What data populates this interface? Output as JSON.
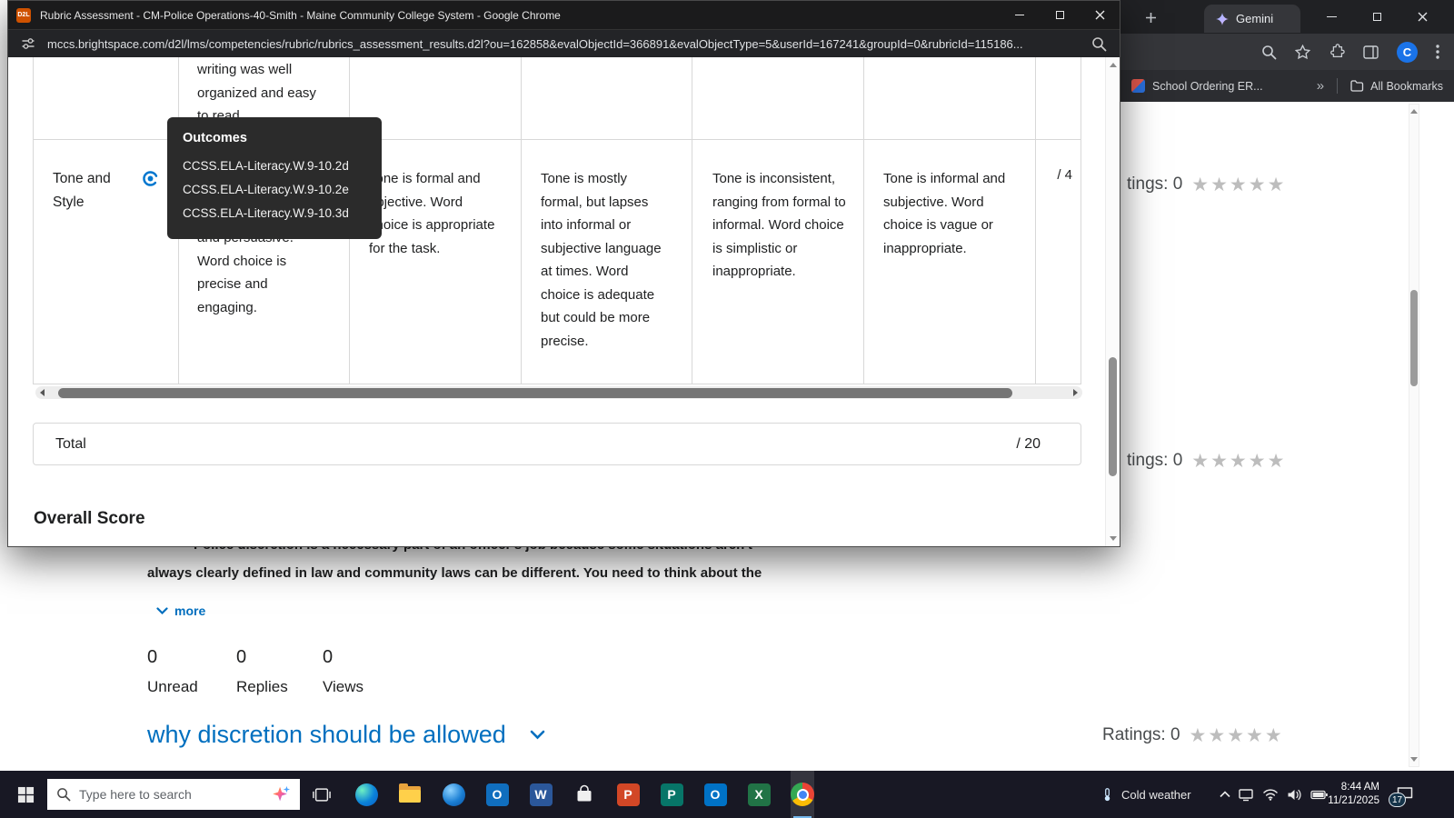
{
  "front_window": {
    "favicon_label": "D2L",
    "title": "Rubric Assessment - CM-Police Operations-40-Smith - Maine Community College System - Google Chrome",
    "url": "mccs.brightspace.com/d2l/lms/competencies/rubric/rubrics_assessment_results.d2l?ou=162858&evalObjectId=366891&evalObjectType=5&userId=167241&groupId=0&rubricId=115186..."
  },
  "rubric": {
    "prev_fragment": "writing was well organized and easy to read.",
    "tooltip_title": "Outcomes",
    "tooltip_items": [
      "CCSS.ELA-Literacy.W.9-10.2d",
      "CCSS.ELA-Literacy.W.9-10.2e",
      "CCSS.ELA-Literacy.W.9-10.3d"
    ],
    "criterion": "Tone and Style",
    "levels": [
      "and persuasive. Word choice is precise and engaging.",
      "Tone is formal and objective. Word choice is appropriate for the task.",
      "Tone is mostly formal, but lapses into informal or subjective language at times. Word choice is adequate but could be more precise.",
      "Tone is inconsistent, ranging from formal to informal. Word choice is simplistic or inappropriate.",
      "Tone is informal and subjective. Word choice is vague or inappropriate."
    ],
    "row_points": "/ 4",
    "total_label": "Total",
    "total_points": "/ 20",
    "overall_heading": "Overall Score"
  },
  "discussion": {
    "post_line1": "Police discretion is a necessary part of an officer's job because some situations aren't",
    "post_line2": "always clearly defined in law and community laws can be different. You need to think about the",
    "more_label": "more",
    "stats": [
      {
        "value": "0",
        "label": "Unread"
      },
      {
        "value": "0",
        "label": "Replies"
      },
      {
        "value": "0",
        "label": "Views"
      }
    ],
    "thread_title": "why discretion should be allowed",
    "ratings_label": "Ratings: 0",
    "ratings_clipped": "tings: 0",
    "stars": "★★★★★"
  },
  "back_window": {
    "tab_label": "Gemini",
    "bookmark_label": "School Ordering ER...",
    "overflow": "»",
    "all_bookmarks_label": "All Bookmarks",
    "avatar_initial": "C"
  },
  "taskbar": {
    "search_placeholder": "Type here to search",
    "weather": "Cold weather",
    "time": "8:44 AM",
    "date": "11/21/2025",
    "badge": "17"
  },
  "colors": {
    "link_blue": "#006fbf",
    "star_gray": "#bdbdbd",
    "avatar_blue": "#1a73e8",
    "taskbar_dark": "#181824",
    "d2l_orange": "#cf5200"
  }
}
